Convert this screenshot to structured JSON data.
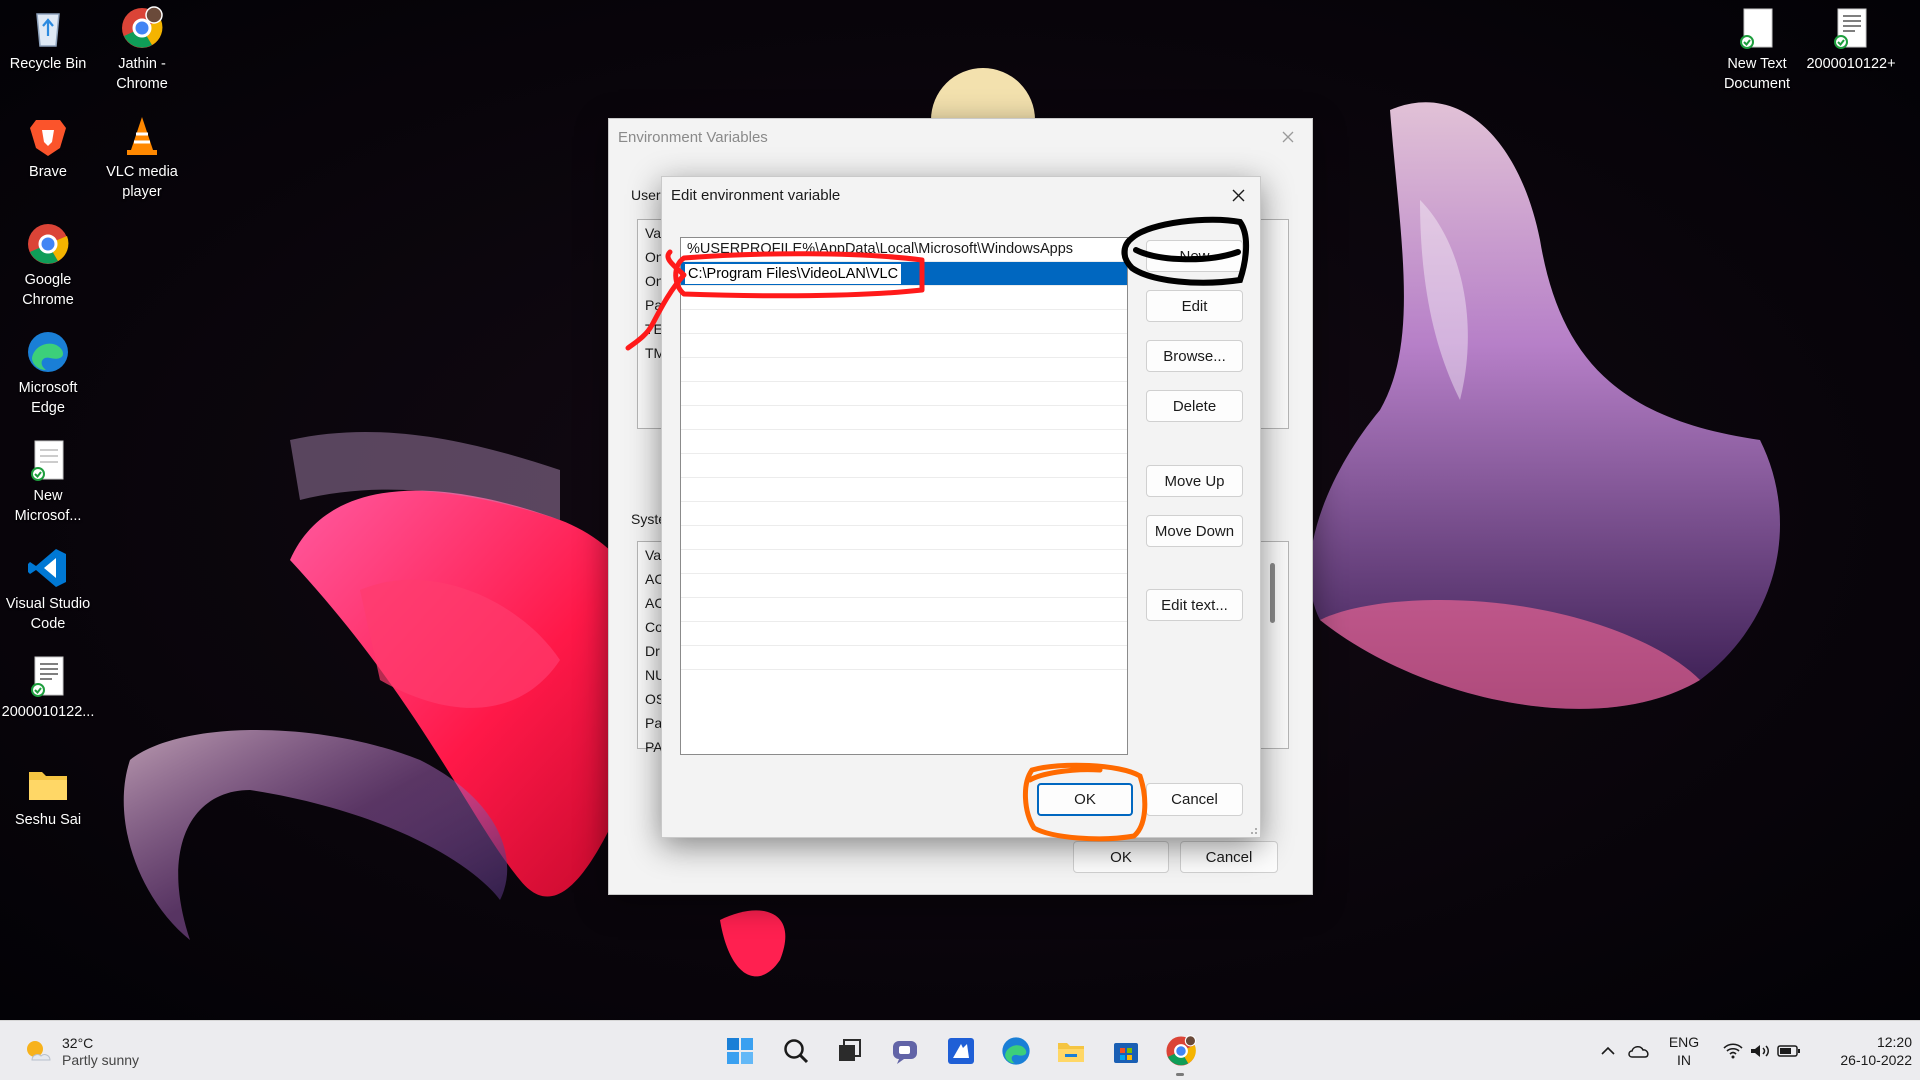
{
  "desktop": {
    "icons_left": [
      {
        "label": "Recycle Bin",
        "icon": "recycle-bin-icon"
      },
      {
        "label": "Jathin - Chrome",
        "icon": "chrome-profile-icon"
      },
      {
        "label": "Brave",
        "icon": "brave-icon"
      },
      {
        "label": "VLC media player",
        "icon": "vlc-icon"
      },
      {
        "label": "Google Chrome",
        "icon": "chrome-icon"
      },
      {
        "label": "Microsoft Edge",
        "icon": "edge-icon"
      },
      {
        "label": "New Microsof...",
        "icon": "word-document-icon"
      },
      {
        "label": "Visual Studio Code",
        "icon": "vscode-icon"
      },
      {
        "label": "2000010122...",
        "icon": "document-icon"
      },
      {
        "label": "Seshu Sai",
        "icon": "folder-icon"
      }
    ],
    "icons_right": [
      {
        "label": "New Text Document",
        "icon": "text-document-icon"
      },
      {
        "label": "2000010122+",
        "icon": "document-icon"
      }
    ]
  },
  "env_dialog": {
    "title": "Environment Variables",
    "user_section_fragment": "User",
    "user_rows_fragments": [
      "Va",
      "On",
      "On",
      "Pa",
      "TE",
      "TM"
    ],
    "system_section_fragment": "Syste",
    "system_rows_fragments": [
      "Va",
      "AC",
      "AC",
      "Co",
      "Dr",
      "NU",
      "OS",
      "Pa",
      "PA"
    ],
    "ok_label": "OK",
    "cancel_label": "Cancel"
  },
  "edit_dialog": {
    "title": "Edit environment variable",
    "paths": [
      "%USERPROFILE%\\AppData\\Local\\Microsoft\\WindowsApps",
      "C:\\Program Files\\VideoLAN\\VLC"
    ],
    "selected_index": 1,
    "empty_rows": 16,
    "buttons": {
      "new": "New",
      "edit": "Edit",
      "browse": "Browse...",
      "delete": "Delete",
      "move_up": "Move Up",
      "move_down": "Move Down",
      "edit_text": "Edit text..."
    },
    "ok_label": "OK",
    "cancel_label": "Cancel"
  },
  "annotation_colors": {
    "red": "#ff1a1a",
    "black": "#000000",
    "orange": "#ff6a00"
  },
  "taskbar": {
    "weather": {
      "temp": "32°C",
      "condition": "Partly sunny"
    },
    "apps": [
      "start-icon",
      "search-icon",
      "task-view-icon",
      "teams-chat-icon",
      "app-icon",
      "edge-icon",
      "file-explorer-icon",
      "store-icon",
      "chrome-icon"
    ],
    "language": {
      "line1": "ENG",
      "line2": "IN"
    },
    "time": "12:20",
    "date": "26-10-2022"
  }
}
